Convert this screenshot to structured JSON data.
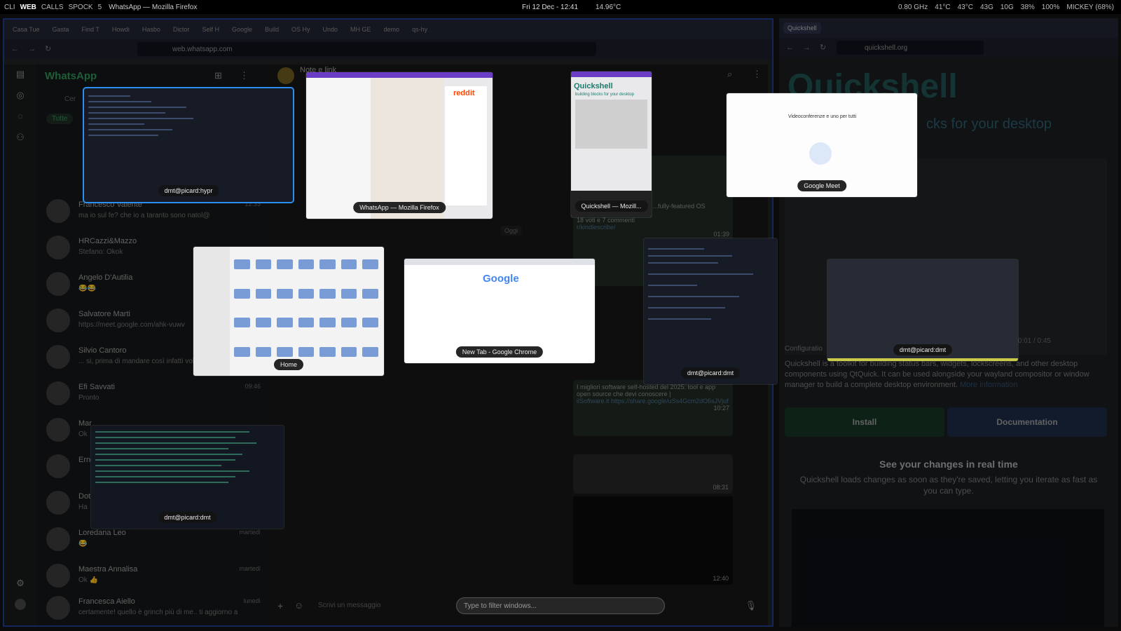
{
  "topbar": {
    "workspaces": [
      "CLI",
      "WEB",
      "CALLS",
      "SPOCK",
      "5"
    ],
    "active_window_title": "WhatsApp — Mozilla Firefox",
    "clock": "Fri 12 Dec - 12:41",
    "weather": "14.96°C",
    "stats": [
      "0.80 GHz",
      "41°C",
      "43°C",
      "43G",
      "10G",
      "38%",
      "100%",
      "MICKEY (68%)"
    ]
  },
  "left_browser": {
    "tabs": [
      "Casa Tue",
      "Gasta",
      "Find T",
      "Howdi",
      "Hasbo",
      "Dictor",
      "Self H",
      "Google",
      "Build",
      "OS Hy",
      "Undo",
      "MH GE",
      "demo",
      "qs-hy"
    ],
    "url": "web.whatsapp.com"
  },
  "whatsapp": {
    "app_title": "WhatsApp",
    "search_partial": "Cer",
    "filter_chip": "Tutte",
    "chats": [
      {
        "name": "Francesco Valente",
        "msg": "ma io sul fe? che io a taranto sono natol@",
        "time": "12:33"
      },
      {
        "name": "HRCazzi&Mazzo",
        "msg": "Stefano: Okok",
        "time": ""
      },
      {
        "name": "Angelo D'Autilia",
        "msg": "😂😂",
        "time": ""
      },
      {
        "name": "Salvatore Marti",
        "msg": "https://meet.google.com/ahk-vuwv",
        "time": ""
      },
      {
        "name": "Silvio Cantoro",
        "msg": "... si, prima di mandare così infatti volev",
        "time": ""
      },
      {
        "name": "Efi Savvati",
        "msg": "Pronto",
        "time": "09:46"
      },
      {
        "name": "Mar",
        "msg": "Ok",
        "time": ""
      },
      {
        "name": "Erne",
        "msg": "",
        "time": ""
      },
      {
        "name": "Dot",
        "msg": "Ha",
        "time": ""
      },
      {
        "name": "Loredana Leo",
        "msg": "😂",
        "time": "martedì"
      },
      {
        "name": "Maestra Annalisa",
        "msg": "Ok 👍",
        "time": "martedì"
      },
      {
        "name": "Francesca Aiello",
        "msg": "certamente! quello è grinch più di me.. ti aggiorno a",
        "time": "lunedì"
      }
    ],
    "chat_header": "Note e link",
    "date_divider": "Oggi",
    "reddit_snippet": "descrive su Reddit: [UPDA ...fully-featured OS replacem",
    "reddit_meta": "18 voti e 7 commenti",
    "reddit_link": "r/kindlescribe/",
    "reddit_time": "01:39",
    "article_title": "I migliori software self-hosted del 2025: tool e app open source che devi conoscere |",
    "article_link": "ilSoftware.it https://share.google/uSs4Gcm2dO6sJVjuf",
    "article_time": "10:27",
    "media_time_1": "08:31",
    "media_time_2": "12:40",
    "message_placeholder": "Scrivi un messaggio"
  },
  "right_browser": {
    "tab_title": "Quickshell",
    "url": "quickshell.org",
    "logo": "Quickshell",
    "tagline": "cks for your desktop",
    "video_time": "0:01 / 0:45",
    "section_label": "Configuratio",
    "description": "Quickshell is a toolkit for building status bars, widgets, lockscreens, and other desktop components using QtQuick. It can be used alongside your wayland compositor or window manager to build a complete desktop environment.",
    "more_info": "More information",
    "install_label": "Install",
    "docs_label": "Documentation",
    "realtime_heading": "See your changes in real time",
    "realtime_text": "Quickshell loads changes as soon as they're saved, letting you iterate as fast as you can type."
  },
  "switcher": {
    "windows": [
      {
        "label": "dmt@picard:hypr",
        "selected": true
      },
      {
        "label": "WhatsApp — Mozilla Firefox",
        "selected": false
      },
      {
        "label": "Quickshell — Mozill...",
        "selected": false
      },
      {
        "label": "Google Meet",
        "selected": false
      },
      {
        "label": "Home",
        "selected": false
      },
      {
        "label": "New Tab - Google Chrome",
        "selected": false
      },
      {
        "label": "dmt@picard:dmt",
        "selected": false
      },
      {
        "label": "dmt@picard:dmt",
        "selected": false
      },
      {
        "label": "dmt@picard:dmt",
        "selected": false
      }
    ],
    "filter_placeholder": "Type to filter windows...",
    "thumb_text": {
      "reddit": "reddit",
      "qs_logo": "Quickshell",
      "qs_sub": "building blocks for your desktop",
      "meet": "Videoconferenze e uno per tutti",
      "google": "Google"
    }
  }
}
